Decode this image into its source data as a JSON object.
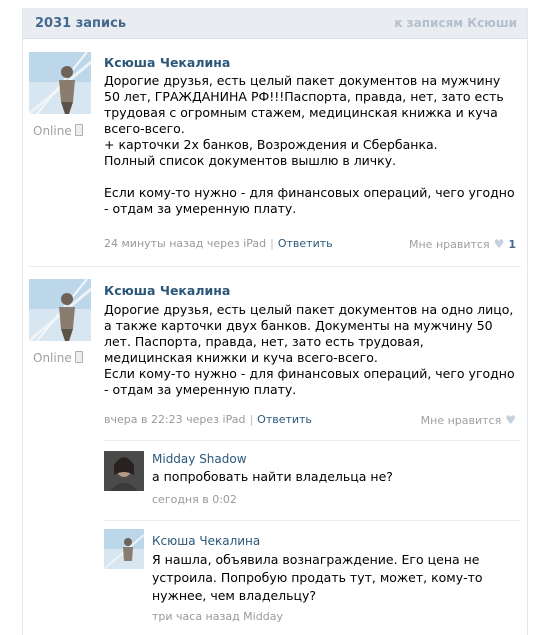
{
  "header": {
    "count": "2031 запись",
    "back_link": "к записям Ксюши"
  },
  "posts": [
    {
      "author": "Ксюша Чекалина",
      "online": "Online",
      "text": "Дорогие друзья, есть целый пакет документов на мужчину\n50 лет, ГРАЖДАНИНА РФ!!!Паспорта, правда, нет, зато есть\nтрудовая с огромным стажем, медицинская книжка и куча\nвсего-всего.\n+ карточки 2х банков, Возрождения и Сбербанка.\nПолный список документов вышлю в личку.\n\nЕсли кому-то нужно - для финансовых операций, чего угодно\n- отдам за умеренную плату.",
      "time": "24 минуты назад через iPad",
      "reply_label": "Ответить",
      "like_label": "Мне нравится",
      "like_count": "1",
      "heart": "heart-icon"
    },
    {
      "author": "Ксюша Чекалина",
      "online": "Online",
      "text": "Дорогие друзья, есть целый пакет документов на одно лицо,\nа также карточки двух банков. Документы на мужчину 50\nлет. Паспорта, правда, нет, зато есть трудовая,\nмедицинская книжки и куча всего-всего.\nЕсли кому-то нужно - для финансовых операций, чего угодно\n- отдам за умеренную плату.",
      "time": "вчера в 22:23 через iPad",
      "reply_label": "Ответить",
      "like_label": "Мне нравится",
      "heart": "heart-icon"
    }
  ],
  "comments": [
    {
      "name": "Midday Shadow",
      "text": "а попробовать найти владельца не?",
      "time": "сегодня в 0:02"
    },
    {
      "name": "Ксюша Чекалина",
      "text": "Я нашла, объявила вознаграждение. Его цена не\nустроила. Попробую продать тут, может, кому-то\nнужнее, чем владельцу?",
      "time": "три часа назад Midday"
    }
  ]
}
